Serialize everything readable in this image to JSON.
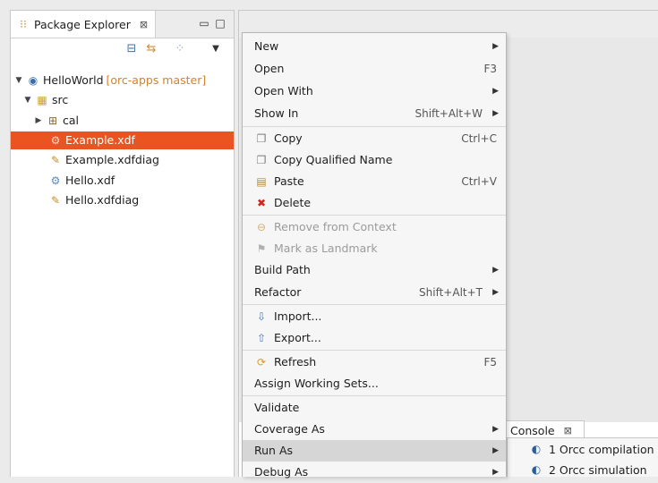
{
  "explorer": {
    "tab_title": "Package Explorer",
    "tab_close": "⊠",
    "tree": {
      "project": "HelloWorld",
      "project_branch": "[orc-apps master]",
      "src": "src",
      "cal": "cal",
      "items": [
        "Example.xdf",
        "Example.xdfdiag",
        "Hello.xdf",
        "Hello.xdfdiag"
      ]
    }
  },
  "context_menu": {
    "items": [
      {
        "label": "New",
        "submenu": true
      },
      {
        "label": "Open",
        "accel": "F3"
      },
      {
        "label": "Open With",
        "submenu": true
      },
      {
        "label": "Show In",
        "accel": "Shift+Alt+W",
        "submenu": true
      },
      {
        "label": "Copy",
        "accel": "Ctrl+C"
      },
      {
        "label": "Copy Qualified Name"
      },
      {
        "label": "Paste",
        "accel": "Ctrl+V"
      },
      {
        "label": "Delete"
      },
      {
        "label": "Remove from Context"
      },
      {
        "label": "Mark as Landmark"
      },
      {
        "label": "Build Path",
        "submenu": true
      },
      {
        "label": "Refactor",
        "accel": "Shift+Alt+T",
        "submenu": true
      },
      {
        "label": "Import..."
      },
      {
        "label": "Export..."
      },
      {
        "label": "Refresh",
        "accel": "F5"
      },
      {
        "label": "Assign Working Sets..."
      },
      {
        "label": "Validate"
      },
      {
        "label": "Coverage As",
        "submenu": true
      },
      {
        "label": "Run As",
        "submenu": true
      },
      {
        "label": "Debug As",
        "submenu": true
      }
    ]
  },
  "console": {
    "tab_title": "Console",
    "tab_close": "⊠"
  },
  "run_as_submenu": {
    "items": [
      "1 Orcc compilation",
      "2 Orcc simulation"
    ]
  },
  "colors": {
    "selection": "#e95420",
    "branch": "#d3822c"
  }
}
